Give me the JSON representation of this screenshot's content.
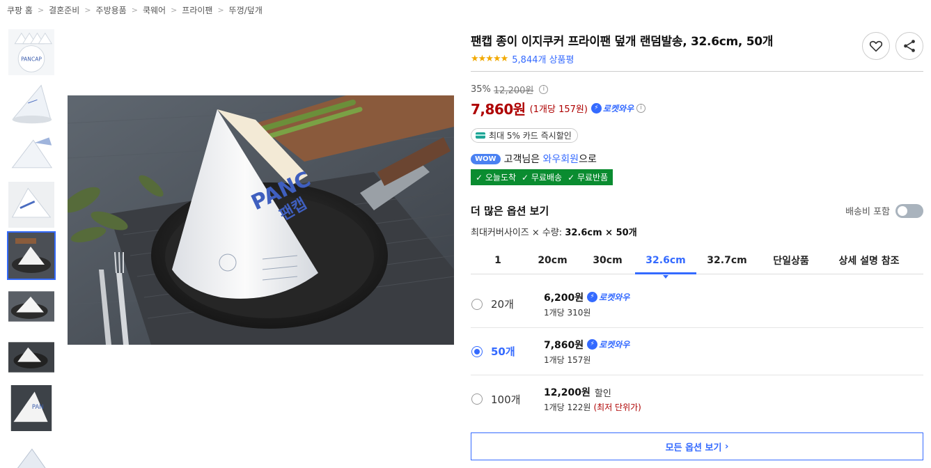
{
  "breadcrumb": [
    "쿠팡 홈",
    "결혼준비",
    "주방용품",
    "쿡웨어",
    "프라이팬",
    "뚜껑/덮개"
  ],
  "product": {
    "title": "팬캡 종이 이지쿠커 프라이팬 덮개 랜덤발송, 32.6cm, 50개",
    "stars": "★★★★★",
    "rating": 4.5,
    "review_count": "5,844개 상품평"
  },
  "price": {
    "discount": "35%",
    "original": "12,200원",
    "sale": "7,860원",
    "unit": "(1개당 157원)",
    "rocket_label": "로켓와우",
    "card_discount": "최대 5% 카드 즉시할인"
  },
  "wow": {
    "badge": "WOW",
    "prefix": "고객님은",
    "member": "와우회원",
    "suffix": "으로",
    "benefits": [
      "오늘도착",
      "무료배송",
      "무료반품"
    ]
  },
  "options": {
    "title": "더 많은 옵션 보기",
    "shipping_toggle_label": "배송비 포함",
    "spec_label": "최대커버사이즈 × 수량:",
    "spec_value": "32.6cm × 50개",
    "size_tabs": [
      "1",
      "20cm",
      "30cm",
      "32.6cm",
      "32.7cm",
      "단일상품",
      "상세 설명 참조"
    ],
    "active_tab": "32.6cm",
    "rows": [
      {
        "qty": "20개",
        "price": "6,200원",
        "badge": "로켓와우",
        "unit": "1개당 310원",
        "note": "",
        "lowest": ""
      },
      {
        "qty": "50개",
        "price": "7,860원",
        "badge": "로켓와우",
        "unit": "1개당 157원",
        "note": "",
        "lowest": ""
      },
      {
        "qty": "100개",
        "price": "12,200원",
        "badge": "",
        "unit": "1개당 122원",
        "note": "할인",
        "lowest": "(최저 단위가)"
      }
    ],
    "selected_row": "50개",
    "all_options_label": "모든 옵션 보기"
  },
  "colors": {
    "accent": "#346aff",
    "price_red": "#ae0000",
    "benefit_green": "#0a8c30",
    "star": "#f2a900"
  },
  "icons": [
    "heart-icon",
    "share-icon",
    "info-icon",
    "rocket-icon",
    "card-icon",
    "chevron-right-icon"
  ]
}
